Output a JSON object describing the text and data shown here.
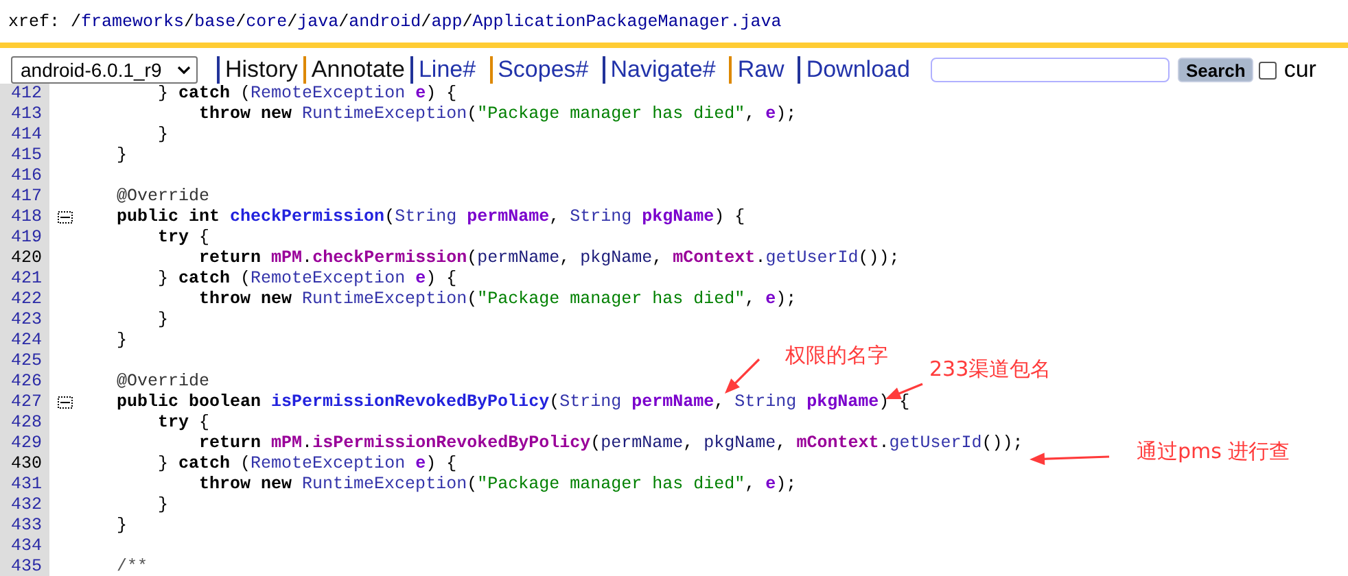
{
  "breadcrumb": {
    "label": "xref:",
    "separator": "/",
    "segments": [
      "frameworks",
      "base",
      "core",
      "java",
      "android",
      "app",
      "ApplicationPackageManager.java"
    ]
  },
  "toolbar": {
    "version": "android-6.0.1_r9",
    "links": [
      {
        "label": "History",
        "visited": true
      },
      {
        "label": "Annotate",
        "visited": true
      },
      {
        "label": "Line#",
        "visited": false
      },
      {
        "label": "Scopes#",
        "visited": false
      },
      {
        "label": "Navigate#",
        "visited": false
      },
      {
        "label": "Raw",
        "visited": false
      },
      {
        "label": "Download",
        "visited": false
      }
    ],
    "search_button": "Search",
    "checkbox": {
      "label": "cur",
      "checked": false
    }
  },
  "code": [
    {
      "number": "412",
      "current": false,
      "foldable": false,
      "tokens": [
        {
          "kind": "plain",
          "text": "        }"
        },
        {
          "kind": "keyword",
          "text": " catch"
        },
        {
          "kind": "plain",
          "text": " ("
        },
        {
          "kind": "type",
          "text": "RemoteException"
        },
        {
          "kind": "param",
          "text": " e"
        },
        {
          "kind": "plain",
          "text": ") {"
        }
      ]
    },
    {
      "number": "413",
      "current": false,
      "foldable": false,
      "tokens": [
        {
          "kind": "keyword",
          "text": "            throw"
        },
        {
          "kind": "keyword",
          "text": " new"
        },
        {
          "kind": "type",
          "text": " RuntimeException"
        },
        {
          "kind": "plain",
          "text": "("
        },
        {
          "kind": "string",
          "text": "\"Package manager has died\""
        },
        {
          "kind": "plain",
          "text": ", "
        },
        {
          "kind": "param",
          "text": "e"
        },
        {
          "kind": "plain",
          "text": ");"
        }
      ]
    },
    {
      "number": "414",
      "current": false,
      "foldable": false,
      "tokens": [
        {
          "kind": "plain",
          "text": "        }"
        }
      ]
    },
    {
      "number": "415",
      "current": false,
      "foldable": false,
      "tokens": [
        {
          "kind": "plain",
          "text": "    }"
        }
      ]
    },
    {
      "number": "416",
      "current": false,
      "foldable": false
    },
    {
      "number": "417",
      "current": false,
      "foldable": false,
      "tokens": [
        {
          "kind": "annotation",
          "text": "    @Override"
        }
      ]
    },
    {
      "number": "418",
      "current": false,
      "foldable": true,
      "tokens": [
        {
          "kind": "keyword",
          "text": "    public"
        },
        {
          "kind": "keyword",
          "text": " int"
        },
        {
          "kind": "declaration",
          "text": " checkPermission"
        },
        {
          "kind": "plain",
          "text": "("
        },
        {
          "kind": "type",
          "text": "String"
        },
        {
          "kind": "param",
          "text": " permName"
        },
        {
          "kind": "plain",
          "text": ", "
        },
        {
          "kind": "type",
          "text": "String"
        },
        {
          "kind": "param",
          "text": " pkgName"
        },
        {
          "kind": "plain",
          "text": ") {"
        }
      ]
    },
    {
      "number": "419",
      "current": false,
      "foldable": false,
      "tokens": [
        {
          "kind": "keyword",
          "text": "        try"
        },
        {
          "kind": "plain",
          "text": " {"
        }
      ]
    },
    {
      "number": "420",
      "current": true,
      "foldable": false,
      "tokens": [
        {
          "kind": "keyword",
          "text": "            return"
        },
        {
          "kind": "field",
          "text": " mPM"
        },
        {
          "kind": "plain",
          "text": "."
        },
        {
          "kind": "member",
          "text": "checkPermission"
        },
        {
          "kind": "plain",
          "text": "("
        },
        {
          "kind": "local",
          "text": "permName"
        },
        {
          "kind": "plain",
          "text": ", "
        },
        {
          "kind": "local",
          "text": "pkgName"
        },
        {
          "kind": "plain",
          "text": ", "
        },
        {
          "kind": "field",
          "text": "mContext"
        },
        {
          "kind": "plain",
          "text": "."
        },
        {
          "kind": "method",
          "text": "getUserId"
        },
        {
          "kind": "plain",
          "text": "());"
        }
      ]
    },
    {
      "number": "421",
      "current": false,
      "foldable": false,
      "tokens": [
        {
          "kind": "plain",
          "text": "        }"
        },
        {
          "kind": "keyword",
          "text": " catch"
        },
        {
          "kind": "plain",
          "text": " ("
        },
        {
          "kind": "type",
          "text": "RemoteException"
        },
        {
          "kind": "param",
          "text": " e"
        },
        {
          "kind": "plain",
          "text": ") {"
        }
      ]
    },
    {
      "number": "422",
      "current": false,
      "foldable": false,
      "tokens": [
        {
          "kind": "keyword",
          "text": "            throw"
        },
        {
          "kind": "keyword",
          "text": " new"
        },
        {
          "kind": "type",
          "text": " RuntimeException"
        },
        {
          "kind": "plain",
          "text": "("
        },
        {
          "kind": "string",
          "text": "\"Package manager has died\""
        },
        {
          "kind": "plain",
          "text": ", "
        },
        {
          "kind": "param",
          "text": "e"
        },
        {
          "kind": "plain",
          "text": ");"
        }
      ]
    },
    {
      "number": "423",
      "current": false,
      "foldable": false,
      "tokens": [
        {
          "kind": "plain",
          "text": "        }"
        }
      ]
    },
    {
      "number": "424",
      "current": false,
      "foldable": false,
      "tokens": [
        {
          "kind": "plain",
          "text": "    }"
        }
      ]
    },
    {
      "number": "425",
      "current": false,
      "foldable": false
    },
    {
      "number": "426",
      "current": false,
      "foldable": false,
      "tokens": [
        {
          "kind": "annotation",
          "text": "    @Override"
        }
      ]
    },
    {
      "number": "427",
      "current": false,
      "foldable": true,
      "tokens": [
        {
          "kind": "keyword",
          "text": "    public"
        },
        {
          "kind": "keyword",
          "text": " boolean"
        },
        {
          "kind": "declaration",
          "text": " isPermissionRevokedByPolicy"
        },
        {
          "kind": "plain",
          "text": "("
        },
        {
          "kind": "type",
          "text": "String"
        },
        {
          "kind": "param",
          "text": " permName"
        },
        {
          "kind": "plain",
          "text": ", "
        },
        {
          "kind": "type",
          "text": "String"
        },
        {
          "kind": "param",
          "text": " pkgName"
        },
        {
          "kind": "plain",
          "text": ") {"
        }
      ]
    },
    {
      "number": "428",
      "current": false,
      "foldable": false,
      "tokens": [
        {
          "kind": "keyword",
          "text": "        try"
        },
        {
          "kind": "plain",
          "text": " {"
        }
      ]
    },
    {
      "number": "429",
      "current": false,
      "foldable": false,
      "tokens": [
        {
          "kind": "keyword",
          "text": "            return"
        },
        {
          "kind": "field",
          "text": " mPM"
        },
        {
          "kind": "plain",
          "text": "."
        },
        {
          "kind": "member",
          "text": "isPermissionRevokedByPolicy"
        },
        {
          "kind": "plain",
          "text": "("
        },
        {
          "kind": "local",
          "text": "permName"
        },
        {
          "kind": "plain",
          "text": ", "
        },
        {
          "kind": "local",
          "text": "pkgName"
        },
        {
          "kind": "plain",
          "text": ", "
        },
        {
          "kind": "field",
          "text": "mContext"
        },
        {
          "kind": "plain",
          "text": "."
        },
        {
          "kind": "method",
          "text": "getUserId"
        },
        {
          "kind": "plain",
          "text": "());"
        }
      ]
    },
    {
      "number": "430",
      "current": true,
      "foldable": false,
      "tokens": [
        {
          "kind": "plain",
          "text": "        }"
        },
        {
          "kind": "keyword",
          "text": " catch"
        },
        {
          "kind": "plain",
          "text": " ("
        },
        {
          "kind": "type",
          "text": "RemoteException"
        },
        {
          "kind": "param",
          "text": " e"
        },
        {
          "kind": "plain",
          "text": ") {"
        }
      ]
    },
    {
      "number": "431",
      "current": false,
      "foldable": false,
      "tokens": [
        {
          "kind": "keyword",
          "text": "            throw"
        },
        {
          "kind": "keyword",
          "text": " new"
        },
        {
          "kind": "type",
          "text": " RuntimeException"
        },
        {
          "kind": "plain",
          "text": "("
        },
        {
          "kind": "string",
          "text": "\"Package manager has died\""
        },
        {
          "kind": "plain",
          "text": ", "
        },
        {
          "kind": "param",
          "text": "e"
        },
        {
          "kind": "plain",
          "text": ");"
        }
      ]
    },
    {
      "number": "432",
      "current": false,
      "foldable": false,
      "tokens": [
        {
          "kind": "plain",
          "text": "        }"
        }
      ]
    },
    {
      "number": "433",
      "current": false,
      "foldable": false,
      "tokens": [
        {
          "kind": "plain",
          "text": "    }"
        }
      ]
    },
    {
      "number": "434",
      "current": false,
      "foldable": false
    },
    {
      "number": "435",
      "current": false,
      "foldable": false,
      "tokens": [
        {
          "kind": "comment",
          "text": "    /**"
        }
      ]
    }
  ],
  "annotations": [
    {
      "text": "权限的名字"
    },
    {
      "text": "233渠道包名"
    },
    {
      "text": "通过pms 进行查"
    }
  ]
}
